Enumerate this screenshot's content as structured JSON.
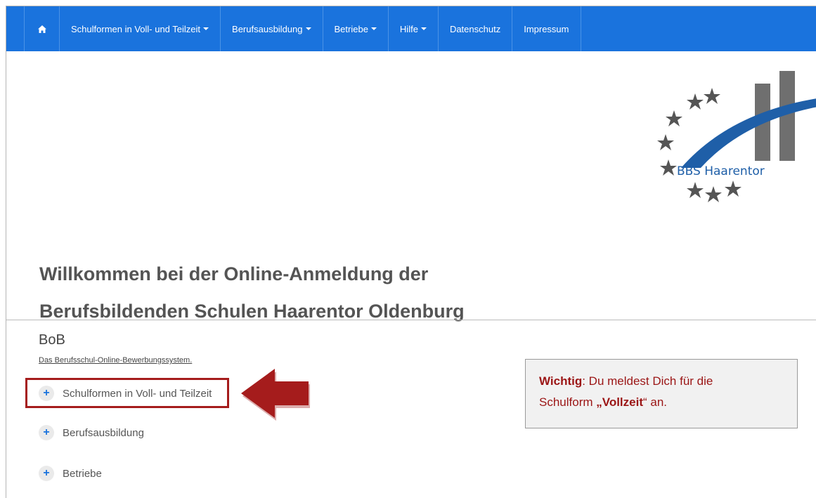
{
  "nav": {
    "home_icon": "home-icon",
    "items": [
      {
        "label": "Schulformen in Voll- und Teilzeit",
        "dropdown": true
      },
      {
        "label": "Berufsausbildung",
        "dropdown": true
      },
      {
        "label": "Betriebe",
        "dropdown": true
      },
      {
        "label": "Hilfe",
        "dropdown": true
      },
      {
        "label": "Datenschutz",
        "dropdown": false
      },
      {
        "label": "Impressum",
        "dropdown": false
      }
    ],
    "bg_color": "#1a73dd"
  },
  "logo": {
    "text": "BBS Haarentor"
  },
  "welcome": {
    "line1": "Willkommen bei der Online-Anmeldung der",
    "line2": "Berufsbildenden Schulen Haarentor Oldenburg"
  },
  "bob": {
    "title": "BoB",
    "subtitle": "Das Berufsschul-Online-Bewerbungssystem.",
    "items": [
      {
        "label": "Schulformen in Voll- und Teilzeit"
      },
      {
        "label": "Berufsausbildung"
      },
      {
        "label": "Betriebe"
      }
    ]
  },
  "notice": {
    "bold1": "Wichtig",
    "text1": ": Du meldest Dich für die",
    "text2": "Schulform ",
    "bold2": "„Vollzeit",
    "text3": "“ an."
  },
  "accent_color": "#a51c1c"
}
